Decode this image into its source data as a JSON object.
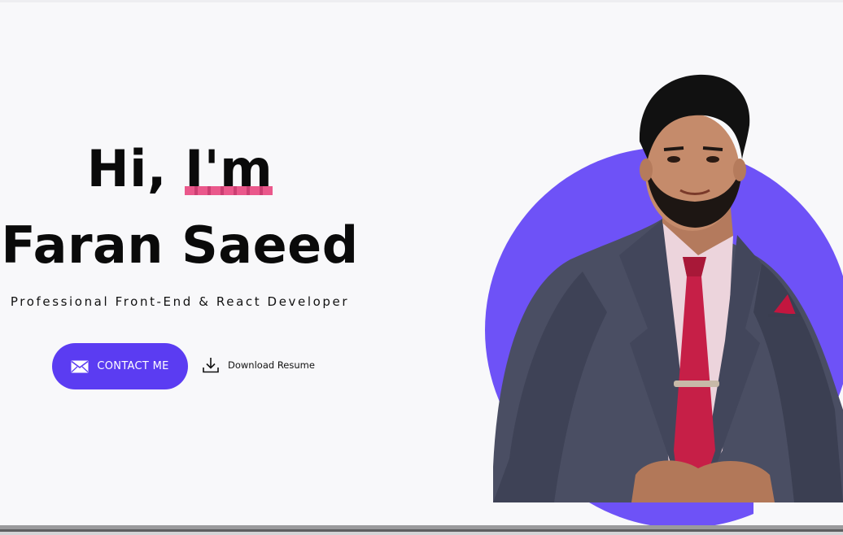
{
  "hero": {
    "greeting_prefix": "Hi,",
    "greeting_highlight": "I'm",
    "name": "Faran Saeed",
    "subtitle": "Professional Front-End & React Developer",
    "contact_label": "CONTACT ME",
    "download_label": "Download Resume",
    "icons": {
      "contact": "envelope-icon",
      "download": "download-icon"
    },
    "colors": {
      "accent": "#5b3cf2",
      "circle": "#6e52f7",
      "highlight": "#e8467f",
      "text": "#0a0a0a",
      "background": "#f8f8fa"
    }
  }
}
